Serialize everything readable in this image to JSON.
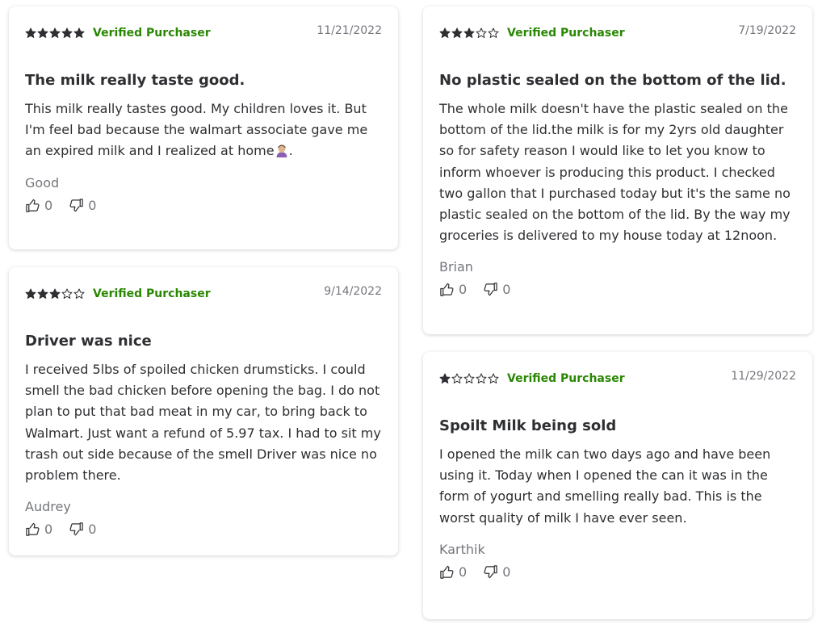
{
  "colors": {
    "verified": "#2a8703",
    "star": "#2e2f32",
    "muted": "#74767c"
  },
  "reviews": [
    {
      "rating": 5,
      "verified": "Verified Purchaser",
      "date": "11/21/2022",
      "title": "The milk really taste good.",
      "body": "This milk really tastes good. My children loves it. But I'm feel bad because the walmart associate gave me an expired milk and I realized at home",
      "body_suffix": ".",
      "emoji_icon": "person-facepalming-icon",
      "author": "Good",
      "helpful": "0",
      "not_helpful": "0"
    },
    {
      "rating": 3,
      "verified": "Verified Purchaser",
      "date": "9/14/2022",
      "title": "Driver was nice",
      "body": "I received 5lbs of spoiled chicken drumsticks. I could smell the bad chicken before opening the bag. I do not plan to put that bad meat in my car, to bring back to Walmart. Just want a refund of 5.97 tax. I had to sit my trash out side because of the smell Driver was nice no problem there.",
      "author": "Audrey",
      "helpful": "0",
      "not_helpful": "0"
    },
    {
      "rating": 3,
      "verified": "Verified Purchaser",
      "date": "7/19/2022",
      "title": "No plastic sealed on the bottom of the lid.",
      "body": "The whole milk doesn't have the plastic sealed on the bottom of the lid.the milk is for my 2yrs old daughter so for safety reason I would like to let you know to inform whoever is producing this product. I checked two gallon that I purchased today but it's the same no plastic sealed on the bottom of the lid. By the way my groceries is delivered to my house today at 12noon.",
      "author": "Brian",
      "helpful": "0",
      "not_helpful": "0"
    },
    {
      "rating": 1,
      "verified": "Verified Purchaser",
      "date": "11/29/2022",
      "title": "Spoilt Milk being sold",
      "body": "I opened the milk can two days ago and have been using it. Today when I opened the can it was in the form of yogurt and smelling really bad. This is the worst quality of milk I have ever seen.",
      "author": "Karthik",
      "helpful": "0",
      "not_helpful": "0"
    }
  ]
}
